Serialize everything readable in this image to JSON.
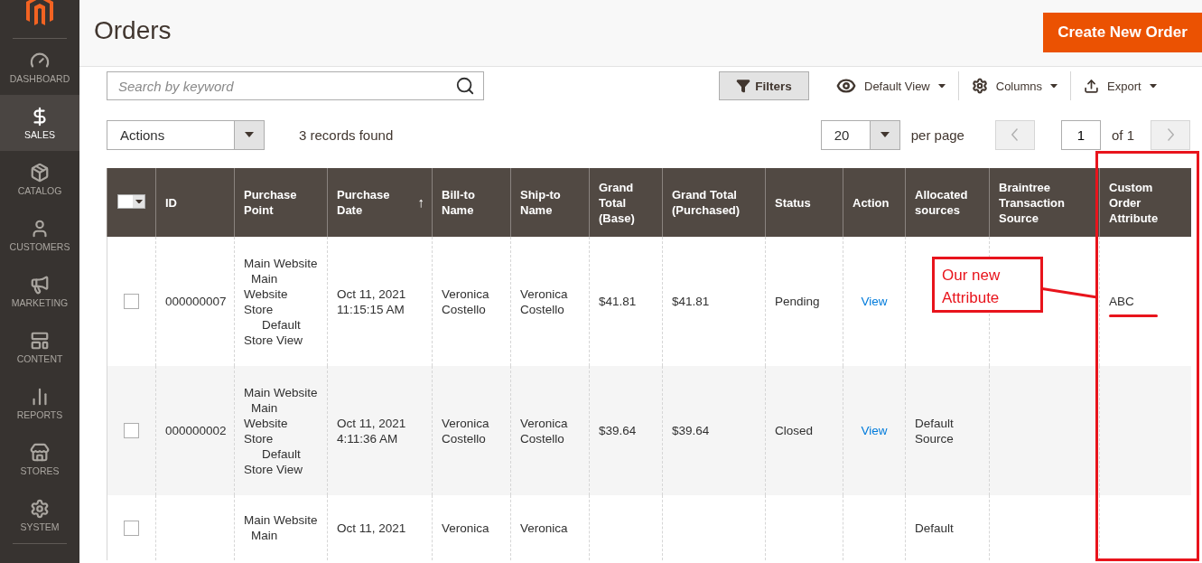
{
  "sidebar": {
    "items": [
      {
        "kind": "dashboard",
        "label": "DASHBOARD",
        "selected": false
      },
      {
        "kind": "sales",
        "label": "SALES",
        "selected": true
      },
      {
        "kind": "catalog",
        "label": "CATALOG",
        "selected": false
      },
      {
        "kind": "customers",
        "label": "CUSTOMERS",
        "selected": false
      },
      {
        "kind": "marketing",
        "label": "MARKETING",
        "selected": false
      },
      {
        "kind": "content",
        "label": "CONTENT",
        "selected": false
      },
      {
        "kind": "reports",
        "label": "REPORTS",
        "selected": false
      },
      {
        "kind": "stores",
        "label": "STORES",
        "selected": false
      },
      {
        "kind": "system",
        "label": "SYSTEM",
        "selected": false
      }
    ]
  },
  "page_title": "Orders",
  "create_button": "Create New Order",
  "search": {
    "placeholder": "Search by keyword"
  },
  "toolbar": {
    "filters": "Filters",
    "view": "Default View",
    "columns": "Columns",
    "export": "Export"
  },
  "actions_select": "Actions",
  "records_found": "3 records found",
  "pagination": {
    "per_page_value": "20",
    "per_page_label": "per page",
    "prev_disabled": true,
    "page": "1",
    "of": "of 1",
    "next_disabled": true
  },
  "table": {
    "select_all_checked": false,
    "columns": [
      {
        "label": "ID"
      },
      {
        "label": "Purchase Point"
      },
      {
        "label": "Purchase Date",
        "sort_mark": "↑"
      },
      {
        "label": "Bill-to Name"
      },
      {
        "label": "Ship-to Name"
      },
      {
        "label": "Grand Total (Base)"
      },
      {
        "label": "Grand Total (Purchased)"
      },
      {
        "label": "Status"
      },
      {
        "label": "Action"
      },
      {
        "label": "Allocated sources"
      },
      {
        "label": "Braintree Transaction Source"
      },
      {
        "label": "Custom Order Attribute"
      }
    ],
    "rows": [
      {
        "checked": false,
        "id": "000000007",
        "purchase_point": [
          {
            "label": "Main Website",
            "children": [
              {
                "label": "Main Website Store",
                "children": [
                  {
                    "label": "Default Store View"
                  }
                ]
              }
            ]
          }
        ],
        "date": "Oct 11, 2021 11:15:15 AM",
        "bill_to": "Veronica Costello",
        "ship_to": "Veronica Costello",
        "total_base": "$41.81",
        "total_purchased": "$41.81",
        "status": "Pending",
        "action": "View",
        "custom": "ABC"
      },
      {
        "checked": false,
        "id": "000000002",
        "purchase_point": [
          {
            "label": "Main Website",
            "children": [
              {
                "label": "Main Website Store",
                "children": [
                  {
                    "label": "Default Store View"
                  }
                ]
              }
            ]
          }
        ],
        "date": "Oct 11, 2021 4:11:36 AM",
        "bill_to": "Veronica Costello",
        "ship_to": "Veronica Costello",
        "total_base": "$39.64",
        "total_purchased": "$39.64",
        "status": "Closed",
        "action": "View",
        "allocated": "Default Source"
      },
      {
        "checked": false,
        "purchase_point": [
          {
            "label": "Main Website",
            "children": [
              {
                "label": "Main"
              }
            ]
          }
        ],
        "date": "Oct 11, 2021",
        "bill_to": "Veronica",
        "ship_to": "Veronica",
        "allocated": "Default"
      }
    ]
  },
  "annotation": {
    "text": "Our new Attribute"
  }
}
